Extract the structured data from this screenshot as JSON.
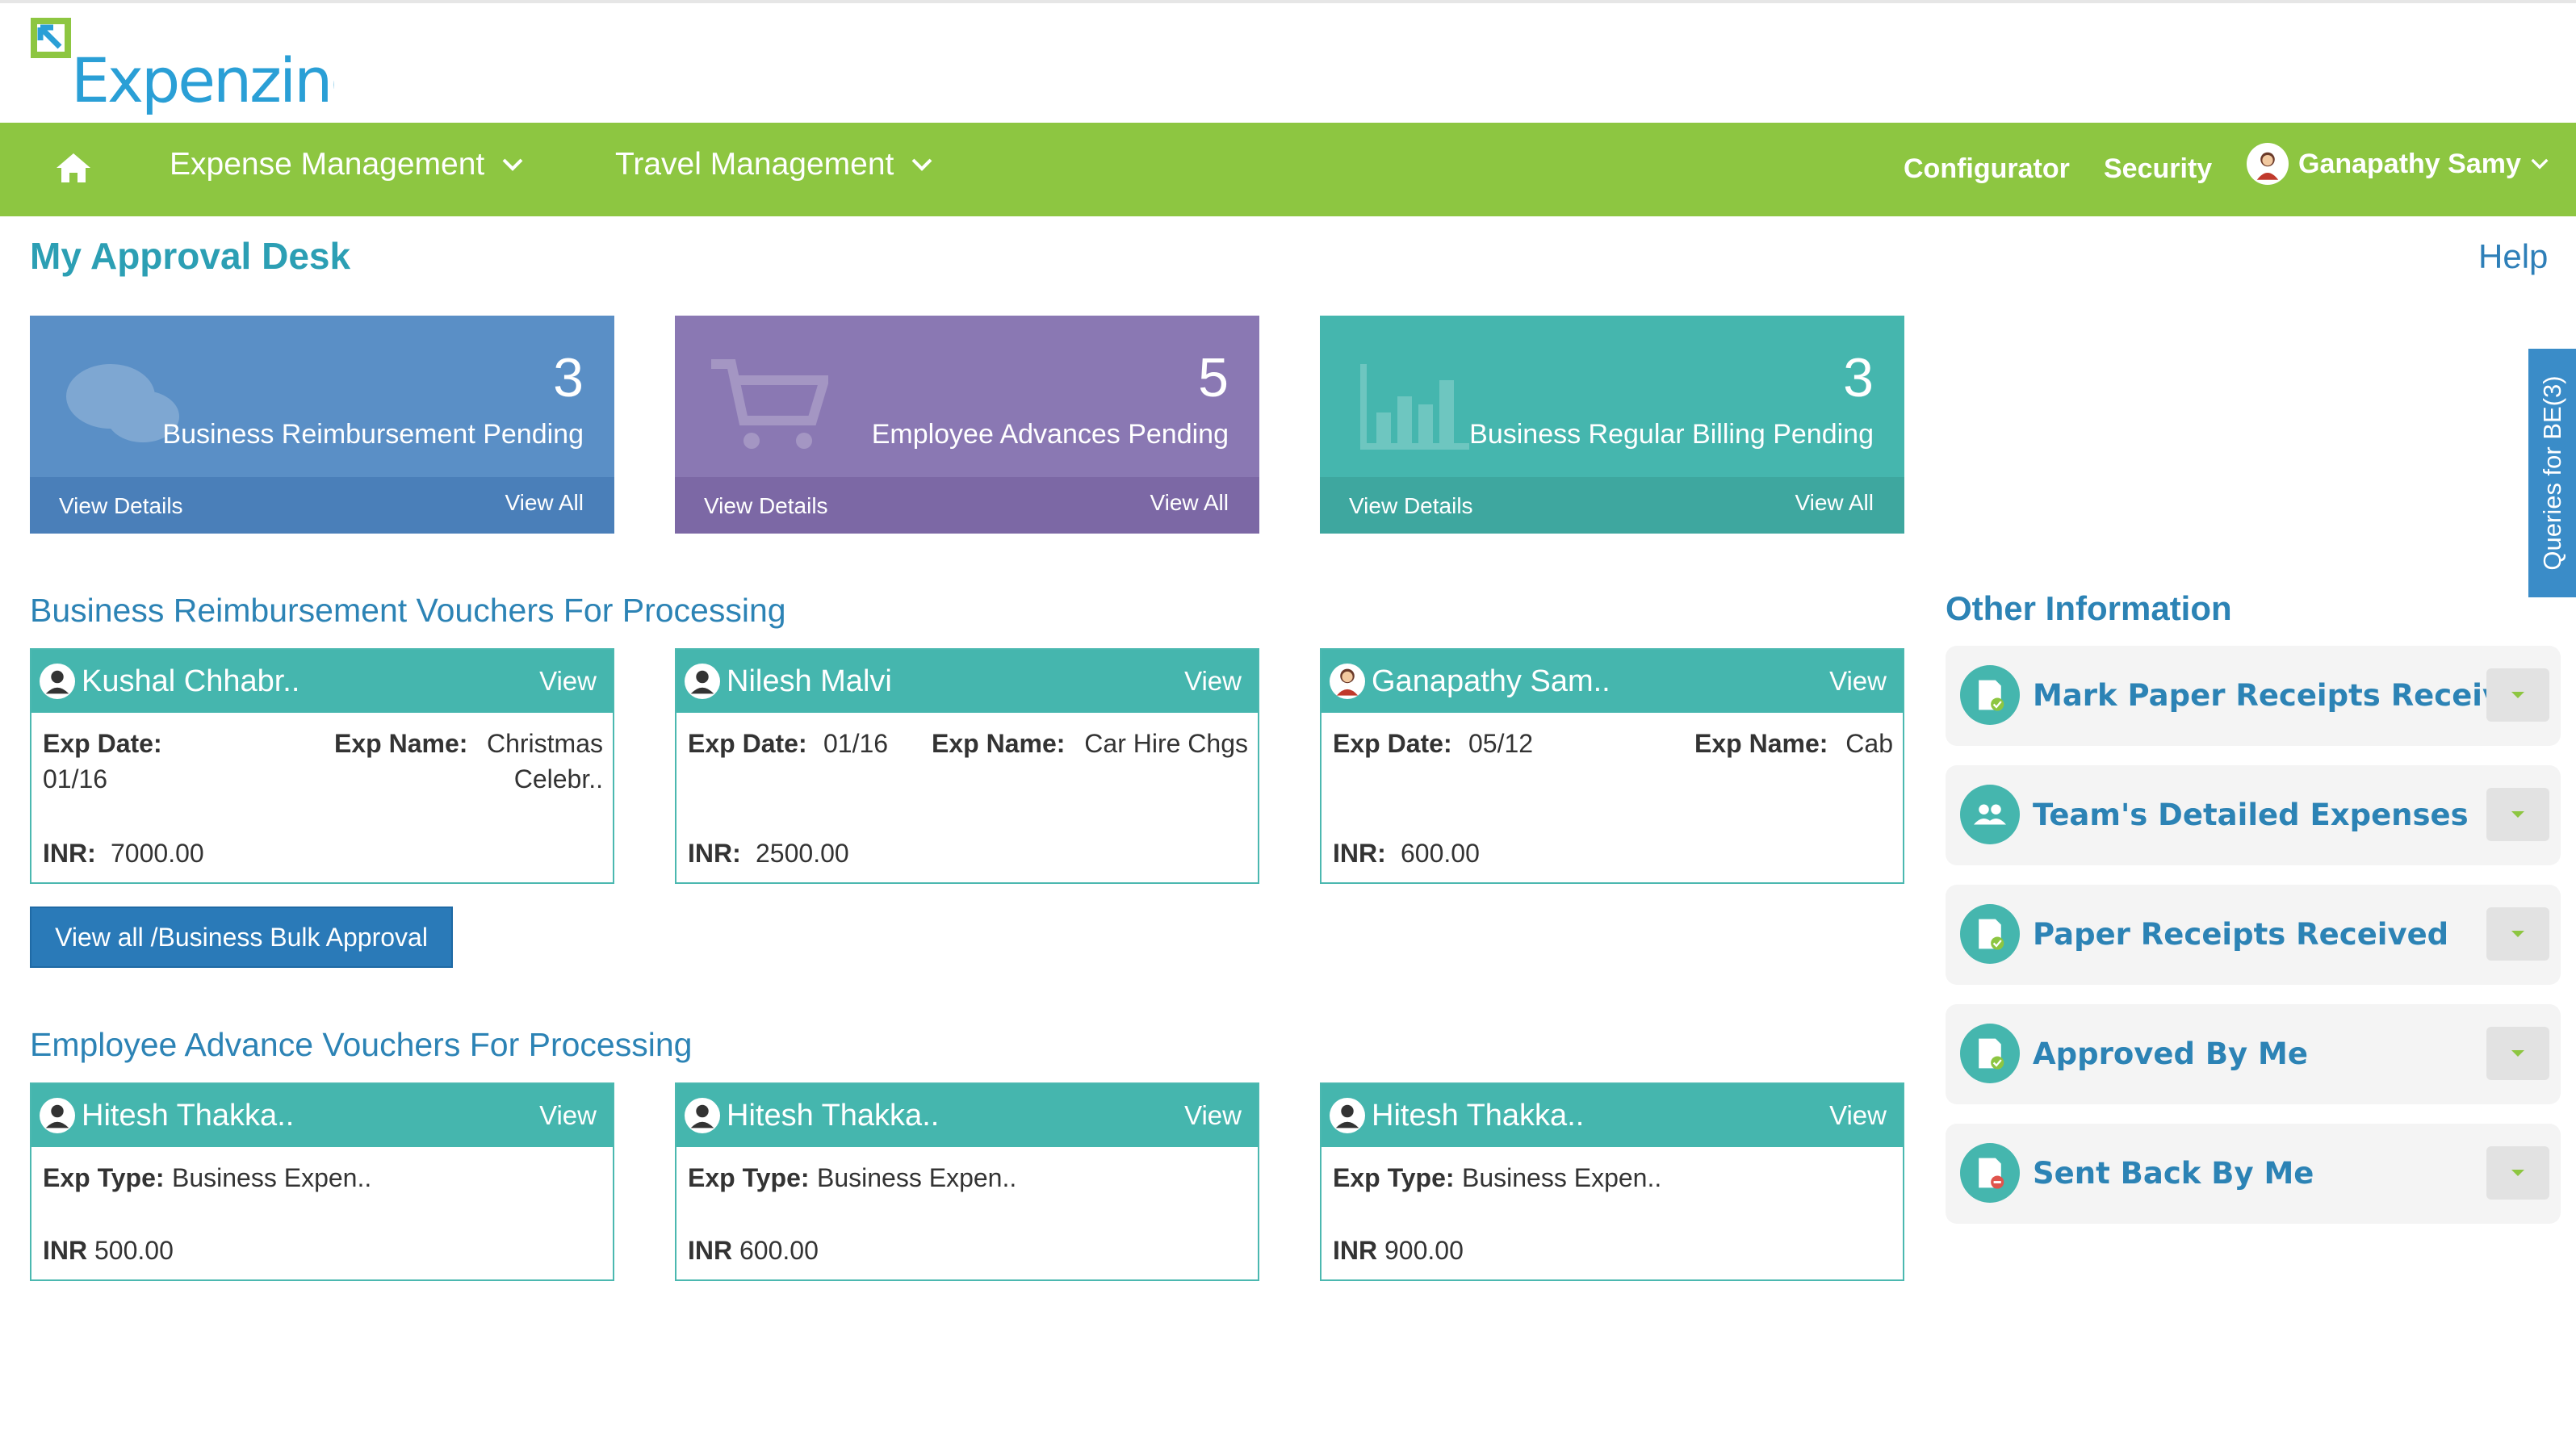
{
  "app": {
    "logo_text": "Expenzing"
  },
  "nav": {
    "expense_management": "Expense Management",
    "travel_management": "Travel Management",
    "configurator": "Configurator",
    "security": "Security",
    "user_name": "Ganapathy Samy"
  },
  "page": {
    "title": "My Approval Desk",
    "help": "Help"
  },
  "tiles": [
    {
      "count": "3",
      "label": "Business Reimbursement Pending",
      "view_details": "View Details",
      "view_all": "View All",
      "color": "#5a8fc6"
    },
    {
      "count": "5",
      "label": "Employee Advances Pending",
      "view_details": "View Details",
      "view_all": "View All",
      "color": "#8a78b3"
    },
    {
      "count": "3",
      "label": "Business Regular Billing Pending",
      "view_details": "View Details",
      "view_all": "View All",
      "color": "#45b6ae"
    }
  ],
  "reimbursement": {
    "title": "Business Reimbursement Vouchers For Processing",
    "labels": {
      "exp_date": "Exp Date:",
      "exp_name": "Exp Name:",
      "inr": "INR:",
      "view": "View"
    },
    "cards": [
      {
        "name": "Kushal Chhabr..",
        "exp_date": "01/16",
        "exp_name_line1": "Christmas",
        "exp_name_line2": "Celebr..",
        "inr": "7000.00"
      },
      {
        "name": "Nilesh Malvi",
        "exp_date": "01/16",
        "exp_name": "Car Hire Chgs",
        "inr": "2500.00"
      },
      {
        "name": "Ganapathy Sam..",
        "exp_date": "05/12",
        "exp_name": "Cab",
        "inr": "600.00"
      }
    ],
    "bulk_button": "View all /Business Bulk Approval"
  },
  "advances": {
    "title": "Employee Advance Vouchers For Processing",
    "labels": {
      "exp_type": "Exp Type:",
      "inr": "INR",
      "view": "View"
    },
    "cards": [
      {
        "name": "Hitesh Thakka..",
        "exp_type": "Business Expen..",
        "inr": "500.00"
      },
      {
        "name": "Hitesh Thakka..",
        "exp_type": "Business Expen..",
        "inr": "600.00"
      },
      {
        "name": "Hitesh Thakka..",
        "exp_type": "Business Expen..",
        "inr": "900.00"
      }
    ]
  },
  "other_info": {
    "title": "Other Information",
    "items": [
      {
        "label": "Mark Paper Receipts Received",
        "icon": "receipt-check-icon"
      },
      {
        "label": "Team's Detailed Expenses",
        "icon": "team-icon"
      },
      {
        "label": "Paper Receipts Received",
        "icon": "receipt-check-icon"
      },
      {
        "label": "Approved By Me",
        "icon": "receipt-check-icon"
      },
      {
        "label": "Sent Back By Me",
        "icon": "receipt-return-icon"
      }
    ]
  },
  "queries_tab": "Queries for BE(3)",
  "colors": {
    "nav_green": "#8dc641",
    "teal": "#45b6ae",
    "blue": "#2a7ab8",
    "purple": "#8a78b3",
    "tile_blue": "#5a8fc6"
  }
}
